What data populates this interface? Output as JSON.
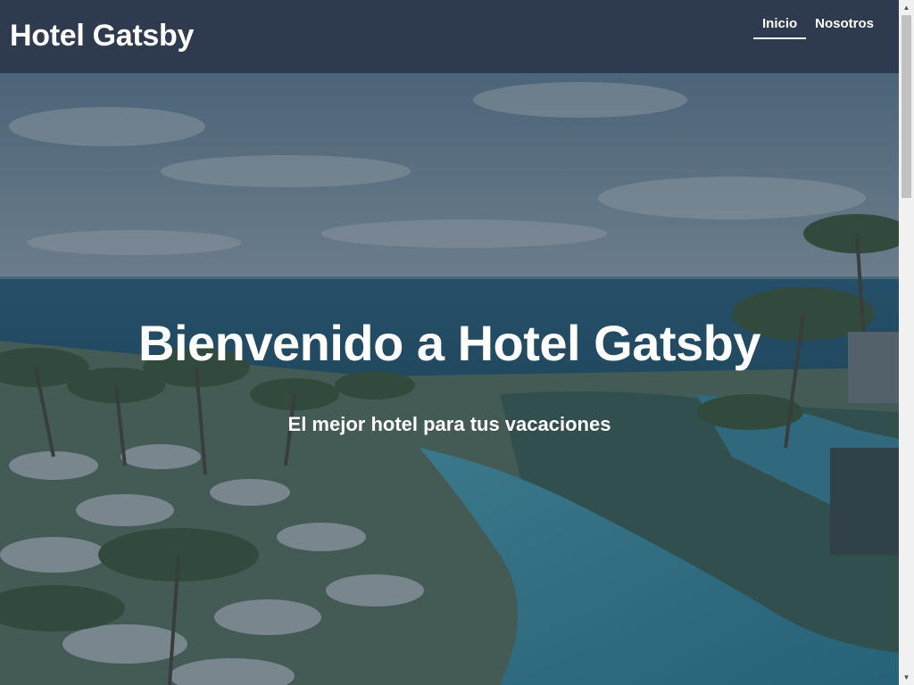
{
  "header": {
    "title": "Hotel Gatsby",
    "nav": [
      {
        "label": "Inicio",
        "active": true
      },
      {
        "label": "Nosotros",
        "active": false
      }
    ]
  },
  "hero": {
    "title": "Bienvenido a Hotel Gatsby",
    "subtitle": "El mejor hotel para tus vacaciones",
    "image": "aerial-resort-pool-ocean-palms"
  },
  "scrollbar": {
    "up_icon": "triangle-up-icon",
    "down_icon": "triangle-down-icon"
  },
  "colors": {
    "header_bg": "#2e3b4e",
    "overlay": "rgba(34,49,63,0.45)",
    "text": "#ffffff"
  }
}
